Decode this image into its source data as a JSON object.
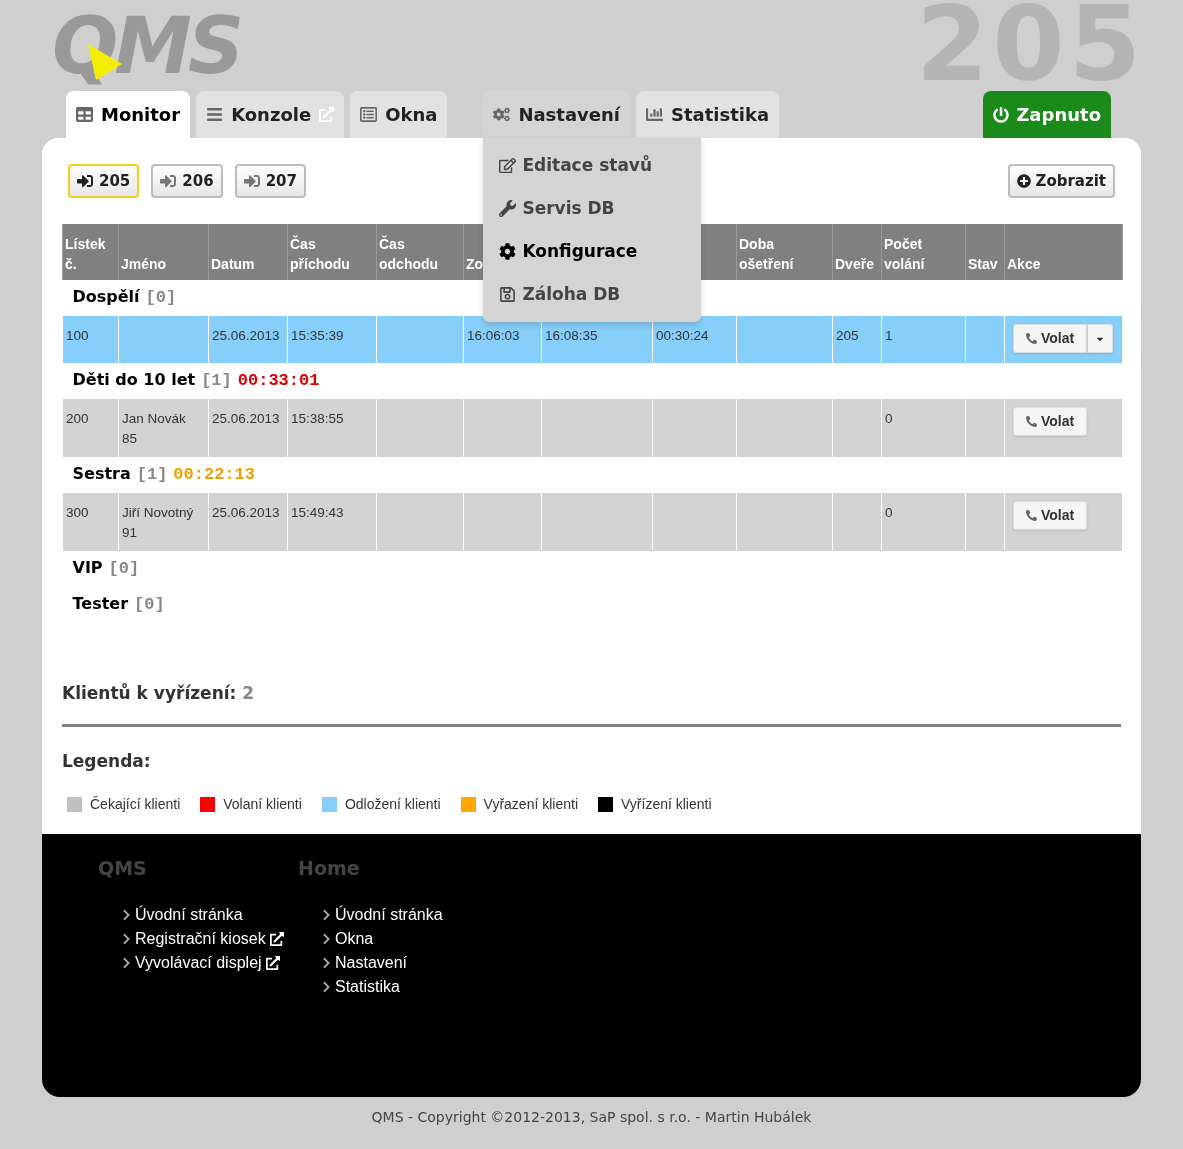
{
  "logo": {
    "text": "QMS"
  },
  "big_number": "205",
  "tabs": [
    {
      "label": "Monitor",
      "selected": true,
      "external": false,
      "expanded": false
    },
    {
      "label": "Konzole",
      "selected": false,
      "external": true,
      "expanded": false
    },
    {
      "label": "Okna",
      "selected": false,
      "external": false,
      "expanded": false
    },
    {
      "label": "Nastavení",
      "selected": false,
      "external": false,
      "expanded": true
    },
    {
      "label": "Statistika",
      "selected": false,
      "external": false,
      "expanded": false
    }
  ],
  "power_button": {
    "label": "Zapnuto",
    "on": true
  },
  "settings_menu": {
    "items": [
      {
        "label": "Editace stavů",
        "highlighted": false
      },
      {
        "label": "Servis DB",
        "highlighted": false
      },
      {
        "label": "Konfigurace",
        "highlighted": true
      },
      {
        "label": "Záloha DB",
        "highlighted": false
      }
    ]
  },
  "doors": [
    {
      "label": "205",
      "selected": true
    },
    {
      "label": "206",
      "selected": false
    },
    {
      "label": "207",
      "selected": false
    }
  ],
  "show_button": {
    "label": "Zobrazit"
  },
  "table": {
    "columns": [
      [
        "Lístek",
        "č."
      ],
      [
        "Jméno"
      ],
      [
        "Datum"
      ],
      [
        "Čas",
        "příchodu"
      ],
      [
        "Čas",
        "odchodu"
      ],
      [
        "Zo"
      ],
      null,
      null,
      [
        "Doba",
        "ošetření"
      ],
      [
        "Dveře"
      ],
      [
        "Počet",
        "volání"
      ],
      [
        "Stav"
      ],
      [
        "Akce"
      ]
    ],
    "groups": [
      {
        "name": "Dospělí",
        "count": "[0]",
        "rows": [
          {
            "color": "#87cefa",
            "cells": [
              "100",
              null,
              "25.06.2013",
              "15:35:39",
              null,
              "16:06:03",
              "16:08:35",
              "00:30:24",
              null,
              "205",
              "1",
              null
            ],
            "action": {
              "label": "Volat",
              "split": true
            }
          }
        ]
      },
      {
        "name": "Děti do 10 let",
        "count": "[1]",
        "time": "00:33:01",
        "color": "#e00000",
        "rows": [
          {
            "color": "#d3d3d3",
            "cells": [
              "200",
              [
                "Jan Novák",
                "85"
              ],
              "25.06.2013",
              "15:38:55",
              null,
              null,
              null,
              null,
              null,
              null,
              "0",
              null
            ],
            "action": {
              "label": "Volat",
              "split": false
            }
          }
        ]
      },
      {
        "name": "Sestra",
        "count": "[1]",
        "time": "00:22:13",
        "color": "#f0a000",
        "rows": [
          {
            "color": "#d3d3d3",
            "cells": [
              "300",
              [
                "Jiří Novotný",
                "91"
              ],
              "25.06.2013",
              "15:49:43",
              null,
              null,
              null,
              null,
              null,
              null,
              "0",
              null
            ],
            "action": {
              "label": "Volat",
              "split": false
            }
          }
        ]
      },
      {
        "name": "VIP",
        "count": "[0]"
      },
      {
        "name": "Tester",
        "count": "[0]"
      }
    ]
  },
  "clients_pending": {
    "label": "Klientů k vyřízení:",
    "value": "2"
  },
  "legend": {
    "title": "Legenda:",
    "items": [
      {
        "label": "Čekající klienti",
        "color": "#c0c0c0"
      },
      {
        "label": "Volaní klienti",
        "color": "#ff0000"
      },
      {
        "label": "Odložení klienti",
        "color": "#87cefa"
      },
      {
        "label": "Vyřazení klienti",
        "color": "#ffa500"
      },
      {
        "label": "Vyřízení klienti",
        "color": "#000000"
      }
    ]
  },
  "footer": {
    "columns": [
      {
        "heading": "QMS",
        "links": [
          {
            "label": "Úvodní stránka",
            "external": false
          },
          {
            "label": "Registrační kiosek",
            "external": true
          },
          {
            "label": "Vyvolávací displej",
            "external": true
          }
        ]
      },
      {
        "heading": "Home",
        "links": [
          {
            "label": "Úvodní stránka",
            "external": false
          },
          {
            "label": "Okna",
            "external": false
          },
          {
            "label": "Nastavení",
            "external": false
          },
          {
            "label": "Statistika",
            "external": false
          }
        ]
      }
    ]
  },
  "copyright": "QMS - Copyright ©2012-2013, SaP spol. s r.o. - Martin Hubálek"
}
